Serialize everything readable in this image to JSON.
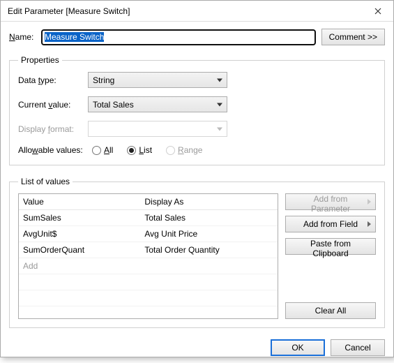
{
  "window": {
    "title": "Edit Parameter [Measure Switch]"
  },
  "name": {
    "label": "Name:",
    "value": "Measure Switch"
  },
  "comment_btn": "Comment >>",
  "properties": {
    "legend": "Properties",
    "data_type": {
      "label": "Data type:",
      "value": "String"
    },
    "current_value": {
      "label": "Current value:",
      "value": "Total Sales"
    },
    "display_format": {
      "label": "Display format:",
      "value": ""
    },
    "allowable": {
      "label": "Allowable values:",
      "all": "All",
      "list": "List",
      "range": "Range",
      "selected": "list"
    }
  },
  "list_of_values": {
    "legend": "List of values",
    "headers": {
      "value": "Value",
      "display_as": "Display As"
    },
    "rows": [
      {
        "value": "SumSales",
        "display": "Total Sales"
      },
      {
        "value": "AvgUnit$",
        "display": "Avg Unit Price"
      },
      {
        "value": "SumOrderQuant",
        "display": "Total Order Quantity"
      }
    ],
    "add_placeholder": "Add",
    "buttons": {
      "add_param": "Add from Parameter",
      "add_field": "Add from Field",
      "paste": "Paste from Clipboard",
      "clear": "Clear All"
    }
  },
  "footer": {
    "ok": "OK",
    "cancel": "Cancel"
  }
}
